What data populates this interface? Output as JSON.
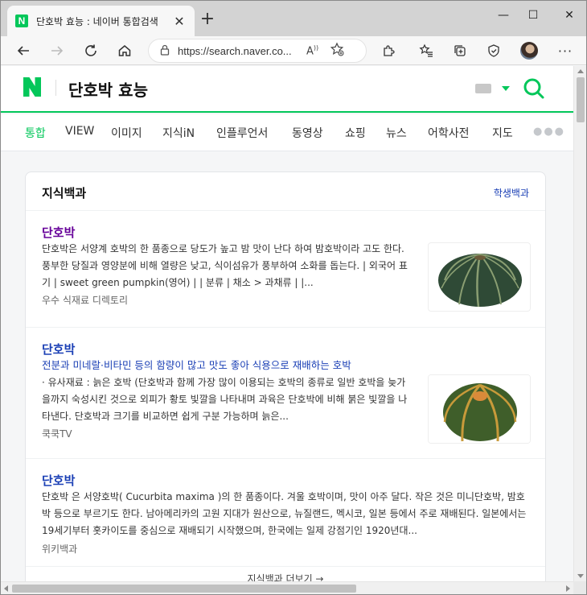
{
  "window": {
    "tab_title": "단호박 효능 : 네이버 통합검색",
    "favicon_text": "N",
    "url": "https://search.naver.co...",
    "read_aloud": "A",
    "icons": [
      "back-icon",
      "forward-icon",
      "refresh-icon",
      "home-icon",
      "lock-icon",
      "add-favorite-icon",
      "extensions-icon",
      "favorites-icon",
      "collections-icon",
      "browser-essentials-icon",
      "profile-avatar",
      "more-icon"
    ]
  },
  "header": {
    "query": "단호박 효능",
    "brand_color": "#03c75a"
  },
  "search_tabs": [
    {
      "label": "통합",
      "active": true
    },
    {
      "label": "VIEW",
      "active": false
    },
    {
      "label": "이미지",
      "active": false
    },
    {
      "label": "지식iN",
      "active": false
    },
    {
      "label": "인플루언서",
      "active": false
    },
    {
      "label": "동영상",
      "active": false
    },
    {
      "label": "쇼핑",
      "active": false
    },
    {
      "label": "뉴스",
      "active": false
    },
    {
      "label": "어학사전",
      "active": false
    },
    {
      "label": "지도",
      "active": false
    }
  ],
  "knowledge_card": {
    "title": "지식백과",
    "link": "학생백과",
    "entries": [
      {
        "title": "단호박",
        "subtitle": "",
        "desc": "단호박은 서양계 호박의 한 품종으로 당도가 높고 밤 맛이 난다 하여 밤호박이라 고도 한다. 풍부한 당질과 영양분에 비해 열량은 낮고, 식이섬유가 풍부하여 소화를 돕는다. | 외국어 표기 | sweet green pumpkin(영어) | | 분류 | 채소 > 과채류 | |...",
        "source": "우수 식재료 디렉토리"
      },
      {
        "title": "단호박",
        "subtitle": "전분과 미네랄·비타민 등의 함량이 많고 맛도 좋아 식용으로 재배하는 호박",
        "desc": "· 유사재료 : 늙은 호박 (단호박과 함께 가장 많이 이용되는 호박의 종류로 일반 호박을 늦가을까지 숙성시킨 것으로 외피가 황토 빛깔을 나타내며 과육은 단호박에 비해 붉은 빛깔을 나타낸다. 단호박과 크기를 비교하면 쉽게 구분 가능하며 늙은...",
        "source": "쿡쿡TV"
      },
      {
        "title": "단호박",
        "subtitle": "",
        "desc": "단호박 은 서양호박( Cucurbita maxima )의 한 품종이다. 겨울 호박이며, 맛이 아주 달다. 작은 것은 미니단호박, 밤호박 등으로 부르기도 한다. 남아메리카의 고원 지대가 원산으로, 뉴질랜드, 멕시코, 일본 등에서 주로 재배된다. 일본에서는 19세기부터 홋카이도를 중심으로 재배되기 시작했으며, 한국에는 일제 강점기인 1920년대...",
        "source": "위키백과"
      }
    ],
    "more": "지식백과 더보기 →"
  }
}
